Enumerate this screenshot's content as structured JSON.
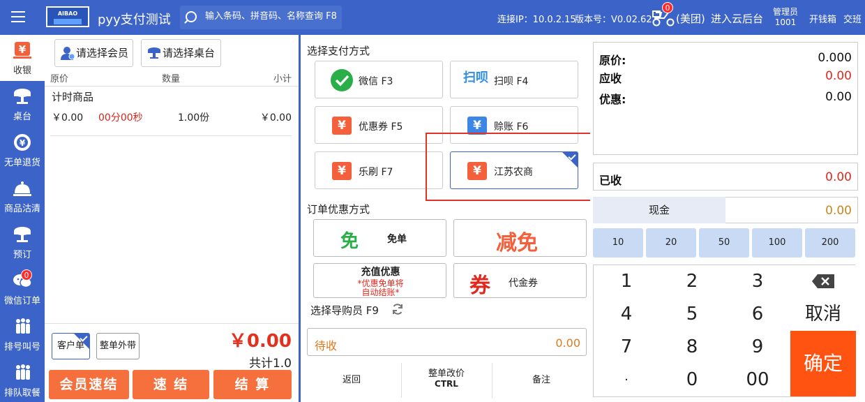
{
  "header": {
    "app_title": "pyy支付测试",
    "logo_text": "AIBAO",
    "search_placeholder": "输入条码、拼音码、名称查询 F8",
    "connection": "连接IP：10.0.2.15",
    "version": "版本号：V0.02.62",
    "meituan_badge": "0",
    "meituan": "(美团)",
    "cloud_backend": "进入云后台",
    "admin_role": "管理员",
    "admin_id": "1001",
    "open_drawer": "开钱箱",
    "handover": "交班"
  },
  "sidenav": {
    "items": [
      {
        "label": "收银",
        "icon": "cashier-icon"
      },
      {
        "label": "桌台",
        "icon": "table-icon"
      },
      {
        "label": "无单退货",
        "icon": "return-icon"
      },
      {
        "label": "商品沽清",
        "icon": "bell-icon"
      },
      {
        "label": "预订",
        "icon": "reserve-icon"
      },
      {
        "label": "微信订单",
        "icon": "wechat-order-icon",
        "badge": "0"
      },
      {
        "label": "排号叫号",
        "icon": "queue-icon"
      },
      {
        "label": "排队取餐",
        "icon": "pickup-icon"
      }
    ]
  },
  "order": {
    "select_member": "请选择会员",
    "select_table": "请选择桌台",
    "columns": [
      "原价",
      "数量",
      "小计"
    ],
    "group_title": "计时商品",
    "rows": [
      {
        "price": "￥0.00",
        "timer": "00分00秒",
        "qty": "1.00份",
        "subtotal": "￥0.00"
      }
    ],
    "customer_order": "客户单",
    "whole_takeout": "整单外带",
    "total_amount": "￥0.00",
    "total_count": "共计1.0",
    "member_quick": "会员速结",
    "quick": "速 结",
    "checkout": "结 算"
  },
  "payment": {
    "title": "选择支付方式",
    "methods": [
      {
        "label": "微信 F3",
        "icon": "wechat-icon"
      },
      {
        "label": "扫呗 F4",
        "icon": "saobei-icon",
        "icon_text": "扫呗"
      },
      {
        "label": "优惠券 F5",
        "icon": "yen-icon",
        "icon_text": "¥"
      },
      {
        "label": "赊账 F6",
        "icon": "credit-icon",
        "icon_text": "¥"
      },
      {
        "label": "乐刷 F7",
        "icon": "yen-icon",
        "icon_text": "¥"
      },
      {
        "label": "江苏农商",
        "icon": "yen-icon",
        "icon_text": "¥",
        "selected": true
      }
    ],
    "discount_title": "订单优惠方式",
    "discounts": {
      "free_big": "免",
      "free_label": "免单",
      "reduce_big": "减免",
      "recharge_title": "充值优惠",
      "recharge_note1": "*优惠免单将",
      "recharge_note2": "自动结账*",
      "voucher_big": "券",
      "voucher_label": "代金券"
    },
    "guide": "选择导购员 F9",
    "pending_label": "待收",
    "pending_amount": "0.00",
    "back": "返回",
    "whole_reprice": "整单改价",
    "whole_reprice_key": "CTRL",
    "remark": "备注"
  },
  "summary": {
    "original_label": "原价:",
    "original_value": "0.000",
    "due_label": "应收",
    "due_value": "0.00",
    "discount_label": "优惠:",
    "discount_value": "0.00",
    "received_label": "已收",
    "received_value": "0.00",
    "cash_label": "现金",
    "cash_value": "0.00",
    "quick_amounts": [
      "10",
      "20",
      "50",
      "100",
      "200"
    ],
    "keys": [
      "1",
      "2",
      "3",
      "4",
      "5",
      "6",
      "7",
      "8",
      "9",
      "·",
      "0",
      "00"
    ],
    "cancel": "取消",
    "confirm": "确定"
  },
  "colors": {
    "primary": "#3c64c8",
    "accent_orange": "#f5703c",
    "confirm": "#ff5312",
    "red_text": "#e0321e",
    "highlight_frame": "#e0322a"
  }
}
